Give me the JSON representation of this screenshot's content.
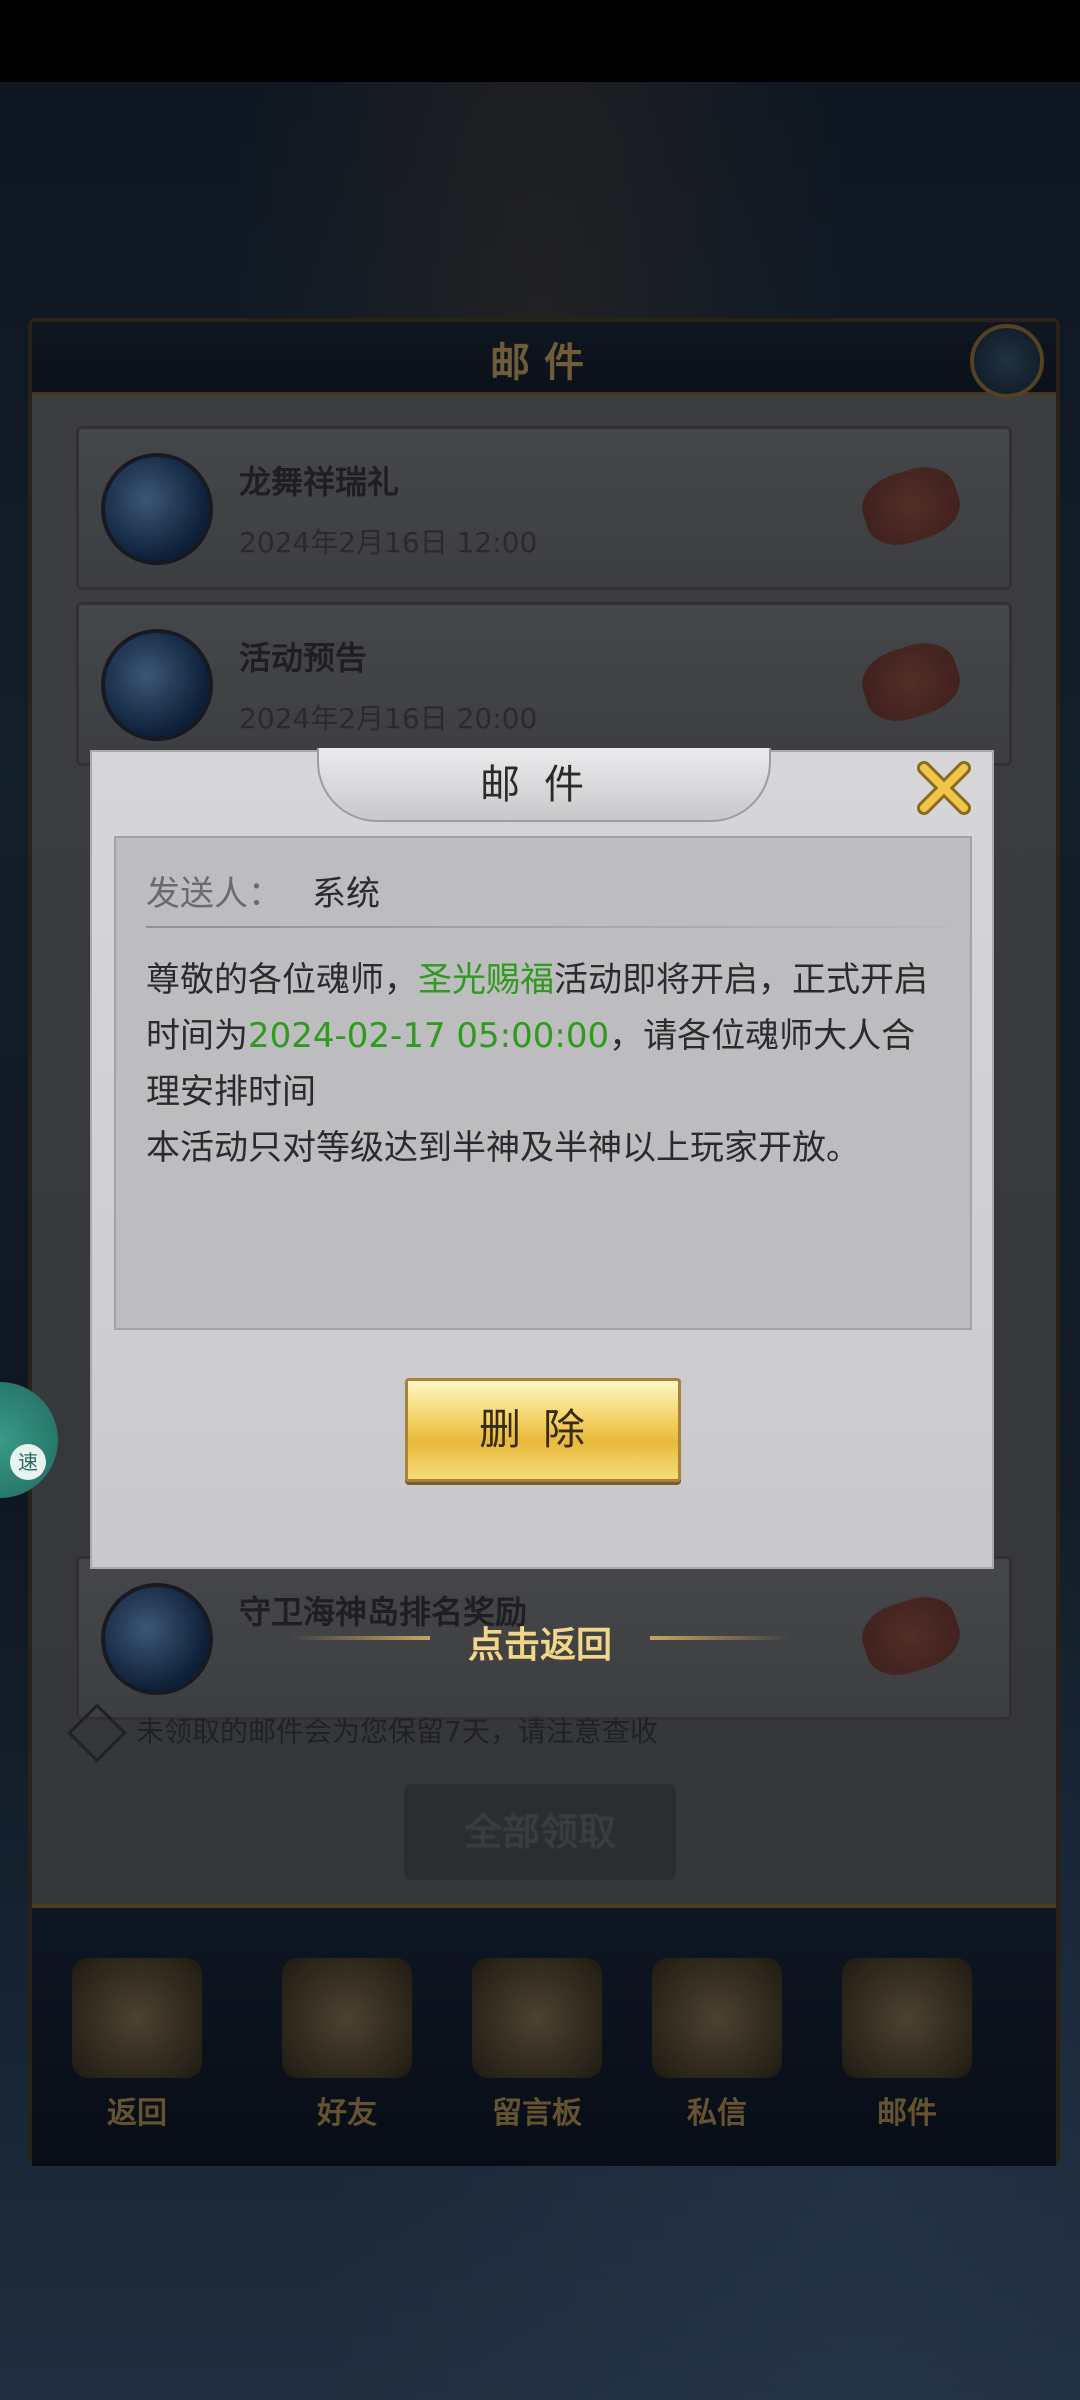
{
  "background": {
    "window_title": "邮件",
    "mails": [
      {
        "title": "龙舞祥瑞礼",
        "date": "2024年2月16日 12:00"
      },
      {
        "title": "活动预告",
        "date": "2024年2月16日 20:00"
      },
      {
        "title": "守卫海神岛排名奖励",
        "date": ""
      }
    ],
    "notice": "未领取的邮件会为您保留7天，请注意查收",
    "claim_all": "全部领取",
    "tabs": [
      "返回",
      "好友",
      "留言板",
      "私信",
      "邮件"
    ]
  },
  "dialog": {
    "title": "邮件",
    "sender_label": "发送人：",
    "sender_value": "系统",
    "body": {
      "p1_a": "尊敬的各位魂师，",
      "p1_highlight": "圣光赐福",
      "p1_b": "活动即将开启，正式开启时间为",
      "p1_time": "2024-02-17 05:00:00",
      "p1_c": "，请各位魂师大人合理安排时间",
      "p2": "本活动只对等级达到半神及半神以上玩家开放。"
    },
    "delete_button": "删除",
    "close_icon": "close-x-icon"
  },
  "back_hint": "点击返回",
  "float_button_label": "速",
  "colors": {
    "highlight_green": "#2e9a1e",
    "gold": "#e8b93a"
  }
}
